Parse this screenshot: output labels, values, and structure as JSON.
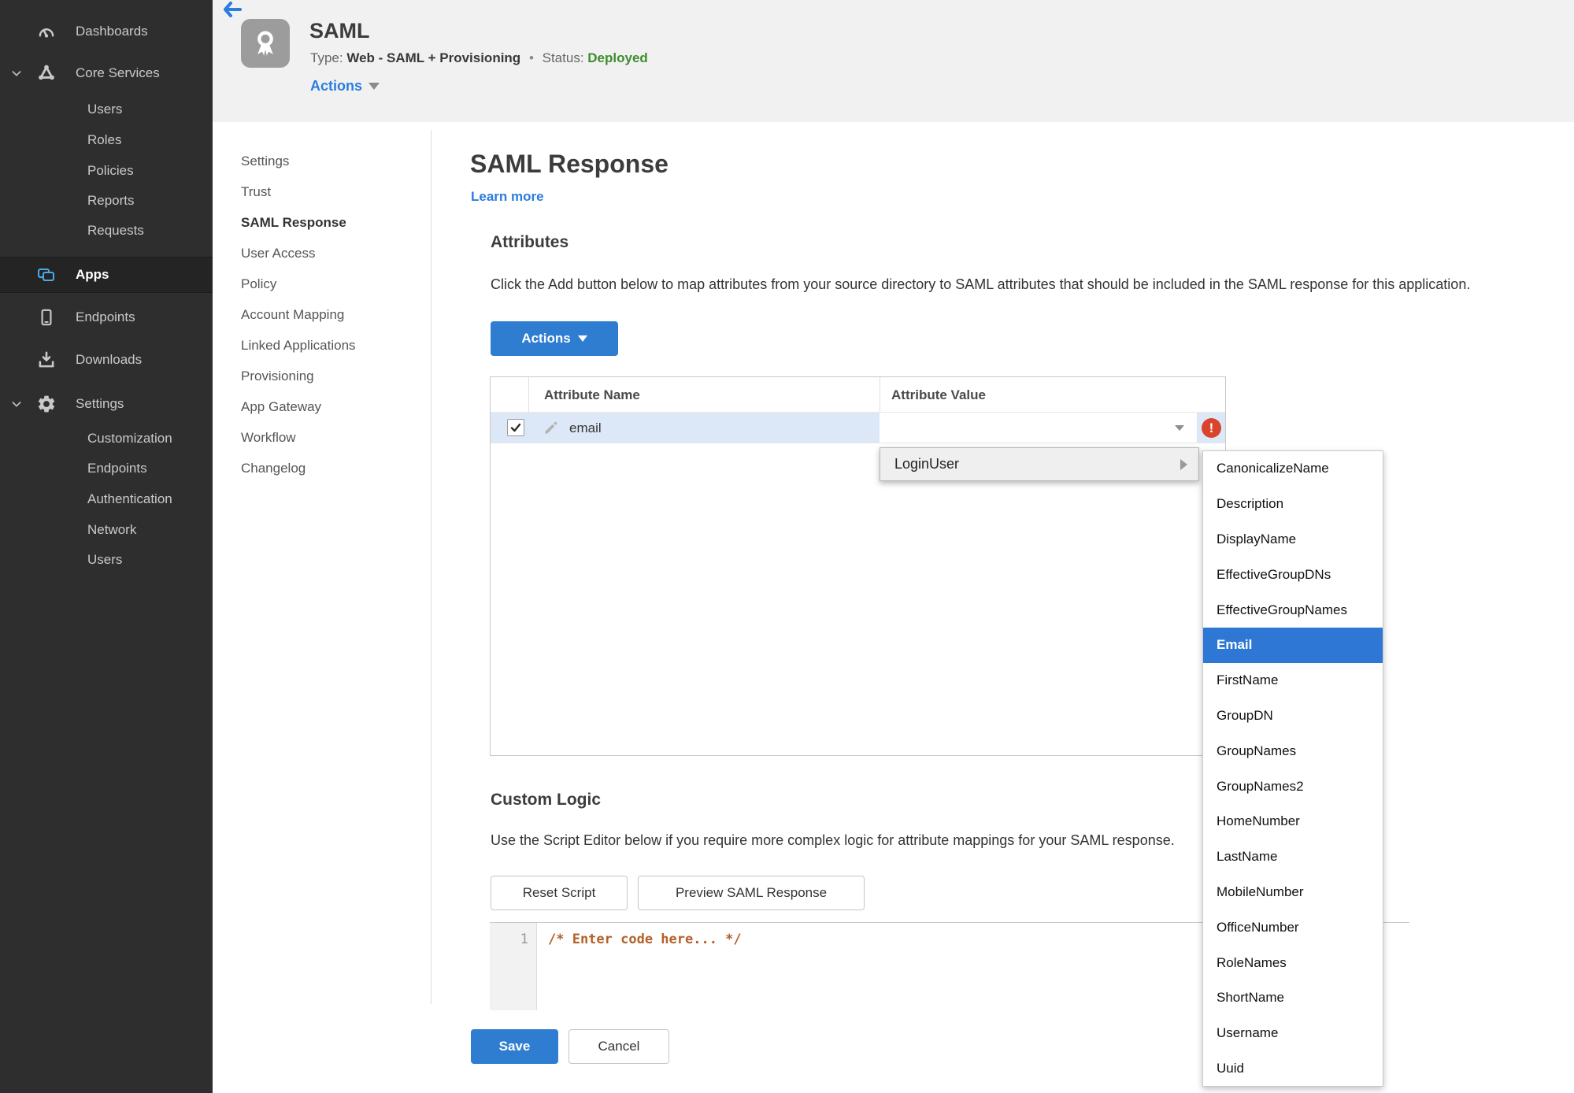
{
  "colors": {
    "accent": "#2e7dd1",
    "link": "#2b7ce0",
    "status_green": "#3c8e2d",
    "error_red": "#d9452c",
    "selection_blue": "#2e77d4",
    "row_highlight": "#dce8f7",
    "code_color": "#b45f29",
    "sidebar_bg": "#2e2e2e",
    "header_bg": "#f1f1f1"
  },
  "sidebar": {
    "items": [
      {
        "label": "Dashboards",
        "icon": "dashboard-icon",
        "level": 0
      },
      {
        "label": "Core Services",
        "icon": "core-services-icon",
        "level": 0,
        "expanded": true
      },
      {
        "label": "Users",
        "level": 1
      },
      {
        "label": "Roles",
        "level": 1
      },
      {
        "label": "Policies",
        "level": 1
      },
      {
        "label": "Reports",
        "level": 1
      },
      {
        "label": "Requests",
        "level": 1
      },
      {
        "label": "Apps",
        "icon": "apps-icon",
        "level": 0,
        "active": true
      },
      {
        "label": "Endpoints",
        "icon": "endpoint-icon",
        "level": 0
      },
      {
        "label": "Downloads",
        "icon": "download-icon",
        "level": 0
      },
      {
        "label": "Settings",
        "icon": "gear-icon",
        "level": 0,
        "expanded": true
      },
      {
        "label": "Customization",
        "level": 1
      },
      {
        "label": "Endpoints",
        "level": 1
      },
      {
        "label": "Authentication",
        "level": 1
      },
      {
        "label": "Network",
        "level": 1
      },
      {
        "label": "Users",
        "level": 1
      }
    ]
  },
  "header": {
    "back_icon": "back-arrow-icon",
    "app_icon": "award-ribbon-icon",
    "title": "SAML",
    "type_label": "Type:",
    "type_value": "Web - SAML + Provisioning",
    "separator": "•",
    "status_label": "Status:",
    "status_value": "Deployed",
    "actions_label": "Actions"
  },
  "subnav": {
    "active": "SAML Response",
    "items": [
      "Settings",
      "Trust",
      "SAML Response",
      "User Access",
      "Policy",
      "Account Mapping",
      "Linked Applications",
      "Provisioning",
      "App Gateway",
      "Workflow",
      "Changelog"
    ]
  },
  "main": {
    "title": "SAML Response",
    "learn_more": "Learn more",
    "attributes": {
      "heading": "Attributes",
      "description": "Click the Add button below to map attributes from your source directory to SAML attributes that should be included in the SAML response for this application.",
      "actions_button": "Actions",
      "table": {
        "columns": [
          "Attribute Name",
          "Attribute Value"
        ],
        "rows": [
          {
            "name": "email",
            "value": "",
            "checked": true,
            "error": true
          }
        ]
      }
    },
    "value_menu": {
      "label": "LoginUser",
      "selected": "Email",
      "submenu": [
        "CanonicalizeName",
        "Description",
        "DisplayName",
        "EffectiveGroupDNs",
        "EffectiveGroupNames",
        "Email",
        "FirstName",
        "GroupDN",
        "GroupNames",
        "GroupNames2",
        "HomeNumber",
        "LastName",
        "MobileNumber",
        "OfficeNumber",
        "RoleNames",
        "ShortName",
        "Username",
        "Uuid"
      ]
    },
    "custom_logic": {
      "heading": "Custom Logic",
      "description": "Use the Script Editor below if you require more complex logic for attribute mappings for your SAML response.",
      "reset_button": "Reset Script",
      "preview_button": "Preview SAML Response",
      "editor": {
        "line_number": "1",
        "code": "/* Enter code here... */"
      }
    },
    "save_button": "Save",
    "cancel_button": "Cancel"
  }
}
